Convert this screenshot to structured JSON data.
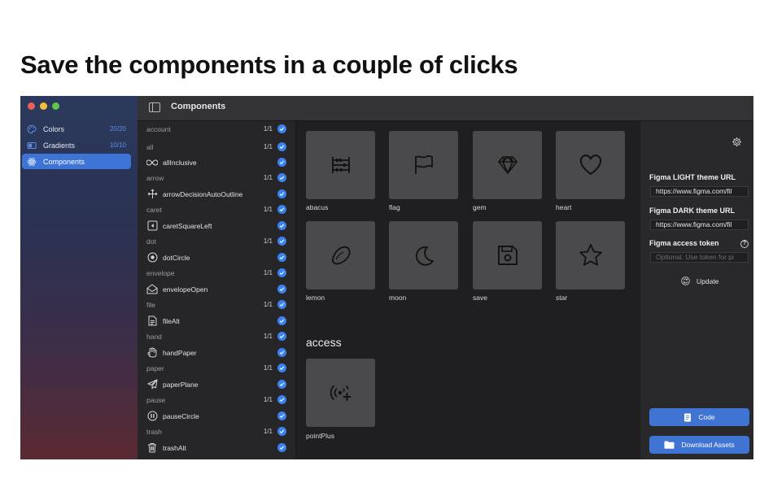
{
  "headline": "Save the components in a couple of clicks",
  "sidebar": {
    "items": [
      {
        "label": "Colors",
        "count": "20/20",
        "icon": "palette-icon"
      },
      {
        "label": "Gradients",
        "count": "10/10",
        "icon": "gradient-icon"
      },
      {
        "label": "Components",
        "count": "",
        "icon": "atom-icon",
        "active": true
      }
    ]
  },
  "titlebar": {
    "title": "Components"
  },
  "list": {
    "rows": [
      {
        "type": "group",
        "label": "account",
        "frac": "1/1"
      },
      {
        "type": "group",
        "label": "all",
        "frac": "1/1"
      },
      {
        "type": "item",
        "label": "allInclusive",
        "icon": "infinity-icon"
      },
      {
        "type": "group",
        "label": "arrow",
        "frac": "1/1"
      },
      {
        "type": "item",
        "label": "arrowDecisionAutoOutline",
        "icon": "arrows-icon"
      },
      {
        "type": "group",
        "label": "caret",
        "frac": "1/1"
      },
      {
        "type": "item",
        "label": "caretSquareLeft",
        "icon": "caret-square-left-icon"
      },
      {
        "type": "group",
        "label": "dot",
        "frac": "1/1"
      },
      {
        "type": "item",
        "label": "dotCircle",
        "icon": "dot-circle-icon"
      },
      {
        "type": "group",
        "label": "envelope",
        "frac": "1/1"
      },
      {
        "type": "item",
        "label": "envelopeOpen",
        "icon": "envelope-open-icon"
      },
      {
        "type": "group",
        "label": "file",
        "frac": "1/1"
      },
      {
        "type": "item",
        "label": "fileAlt",
        "icon": "file-icon"
      },
      {
        "type": "group",
        "label": "hand",
        "frac": "1/1"
      },
      {
        "type": "item",
        "label": "handPaper",
        "icon": "hand-icon"
      },
      {
        "type": "group",
        "label": "paper",
        "frac": "1/1"
      },
      {
        "type": "item",
        "label": "paperPlane",
        "icon": "paper-plane-icon"
      },
      {
        "type": "group",
        "label": "pause",
        "frac": "1/1"
      },
      {
        "type": "item",
        "label": "pauseCircle",
        "icon": "pause-circle-icon"
      },
      {
        "type": "group",
        "label": "trash",
        "frac": "1/1"
      },
      {
        "type": "item",
        "label": "trashAlt",
        "icon": "trash-icon"
      }
    ]
  },
  "grid": {
    "tiles": [
      {
        "label": "abacus",
        "icon": "abacus-icon"
      },
      {
        "label": "flag",
        "icon": "flag-icon"
      },
      {
        "label": "gem",
        "icon": "gem-icon"
      },
      {
        "label": "heart",
        "icon": "heart-icon"
      },
      {
        "label": "lemon",
        "icon": "lemon-icon"
      },
      {
        "label": "moon",
        "icon": "moon-icon"
      },
      {
        "label": "save",
        "icon": "save-icon"
      },
      {
        "label": "star",
        "icon": "star-icon"
      }
    ],
    "section": "access",
    "section_tiles": [
      {
        "label": "pointPlus",
        "icon": "point-plus-icon"
      }
    ]
  },
  "panel": {
    "light_label": "Figma LIGHT theme URL",
    "light_value": "https://www.figma.com/fil",
    "dark_label": "Figma DARK theme URL",
    "dark_value": "https://www.figma.com/fil",
    "token_label": "Figma access token",
    "token_placeholder": "Optional. Use token for pi",
    "help": "?",
    "update_label": "Update",
    "code_label": "Code",
    "download_label": "Download Assets"
  },
  "colors": {
    "accent": "#3f74d3",
    "check": "#3a82f0"
  }
}
